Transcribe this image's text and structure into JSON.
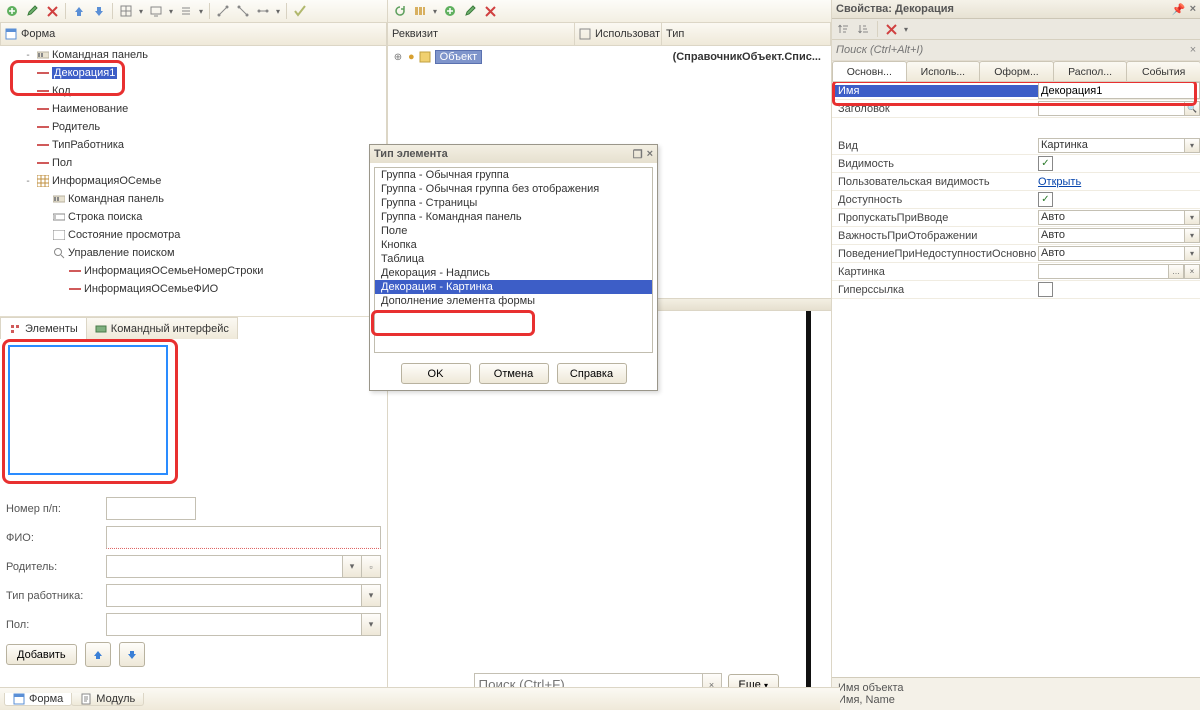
{
  "left": {
    "root": "Форма",
    "items": [
      {
        "label": "Командная панель",
        "icon": "bar",
        "depth": 1,
        "exp": "-"
      },
      {
        "label": "Декорация1",
        "icon": "dash",
        "depth": 1,
        "exp": "",
        "hl": true
      },
      {
        "label": "Код",
        "icon": "dash",
        "depth": 1,
        "exp": ""
      },
      {
        "label": "Наименование",
        "icon": "dash",
        "depth": 1,
        "exp": ""
      },
      {
        "label": "Родитель",
        "icon": "dash",
        "depth": 1,
        "exp": ""
      },
      {
        "label": "ТипРаботника",
        "icon": "dash",
        "depth": 1,
        "exp": ""
      },
      {
        "label": "Пол",
        "icon": "dash",
        "depth": 1,
        "exp": ""
      },
      {
        "label": "ИнформацияОСемье",
        "icon": "table",
        "depth": 1,
        "exp": "-"
      },
      {
        "label": "Командная панель",
        "icon": "bar",
        "depth": 2,
        "exp": ""
      },
      {
        "label": "Строка поиска",
        "icon": "input",
        "depth": 2,
        "exp": ""
      },
      {
        "label": "Состояние просмотра",
        "icon": "box",
        "depth": 2,
        "exp": ""
      },
      {
        "label": "Управление поиском",
        "icon": "search",
        "depth": 2,
        "exp": ""
      },
      {
        "label": "ИнформацияОСемьеНомерСтроки",
        "icon": "dash",
        "depth": 3,
        "exp": ""
      },
      {
        "label": "ИнформацияОСемьеФИО",
        "icon": "dash",
        "depth": 3,
        "exp": ""
      }
    ],
    "tabs": {
      "a": "Элементы",
      "b": "Командный интерфейс"
    }
  },
  "mid": {
    "cols": {
      "a": "Реквизит",
      "b": "Использоват",
      "c": "Тип"
    },
    "obj": "Объект",
    "objtype": "(СправочникОбъект.Спис..."
  },
  "preview": {
    "labels": {
      "num": "Номер п/п:",
      "fio": "ФИО:",
      "parent": "Родитель:",
      "type": "Тип работника:",
      "pol": "Пол:"
    },
    "add": "Добавить",
    "search_ph": "Поиск (Ctrl+F)",
    "more": "Еще"
  },
  "dialog": {
    "title": "Тип элемента",
    "items": [
      "Группа - Обычная группа",
      "Группа - Обычная группа без отображения",
      "Группа - Страницы",
      "Группа - Командная панель",
      "Поле",
      "Кнопка",
      "Таблица",
      "Декорация - Надпись",
      "Декорация - Картинка",
      "Дополнение элемента формы"
    ],
    "ok": "OK",
    "cancel": "Отмена",
    "help": "Справка"
  },
  "props": {
    "title": "Свойства: Декорация",
    "search_ph": "Поиск (Ctrl+Alt+I)",
    "tabs": [
      "Основн...",
      "Исполь...",
      "Оформ...",
      "Распол...",
      "События"
    ],
    "rows": {
      "name_l": "Имя",
      "name_v": "Декорация1",
      "title_l": "Заголовок",
      "kind_l": "Вид",
      "kind_v": "Картинка",
      "vis_l": "Видимость",
      "uvis_l": "Пользовательская видимость",
      "uvis_v": "Открыть",
      "avail_l": "Доступность",
      "skip_l": "ПропускатьПриВводе",
      "skip_v": "Авто",
      "imp_l": "ВажностьПриОтображении",
      "imp_v": "Авто",
      "beh_l": "ПоведениеПриНедоступностиОсновно",
      "beh_v": "Авто",
      "pic_l": "Картинка",
      "pic_v": "",
      "link_l": "Гиперссылка"
    },
    "foot1": "Имя объекта",
    "foot2": "Имя, Name"
  },
  "bottom": {
    "a": "Форма",
    "b": "Модуль"
  },
  "glyph": {
    "x": "×",
    "pin": "📌",
    "minus": "−",
    "tri": "▾",
    "up": "↑",
    "dn": "↓",
    "chk": "✓",
    "dots": "…",
    "q": "🔍",
    "win": "❐"
  }
}
